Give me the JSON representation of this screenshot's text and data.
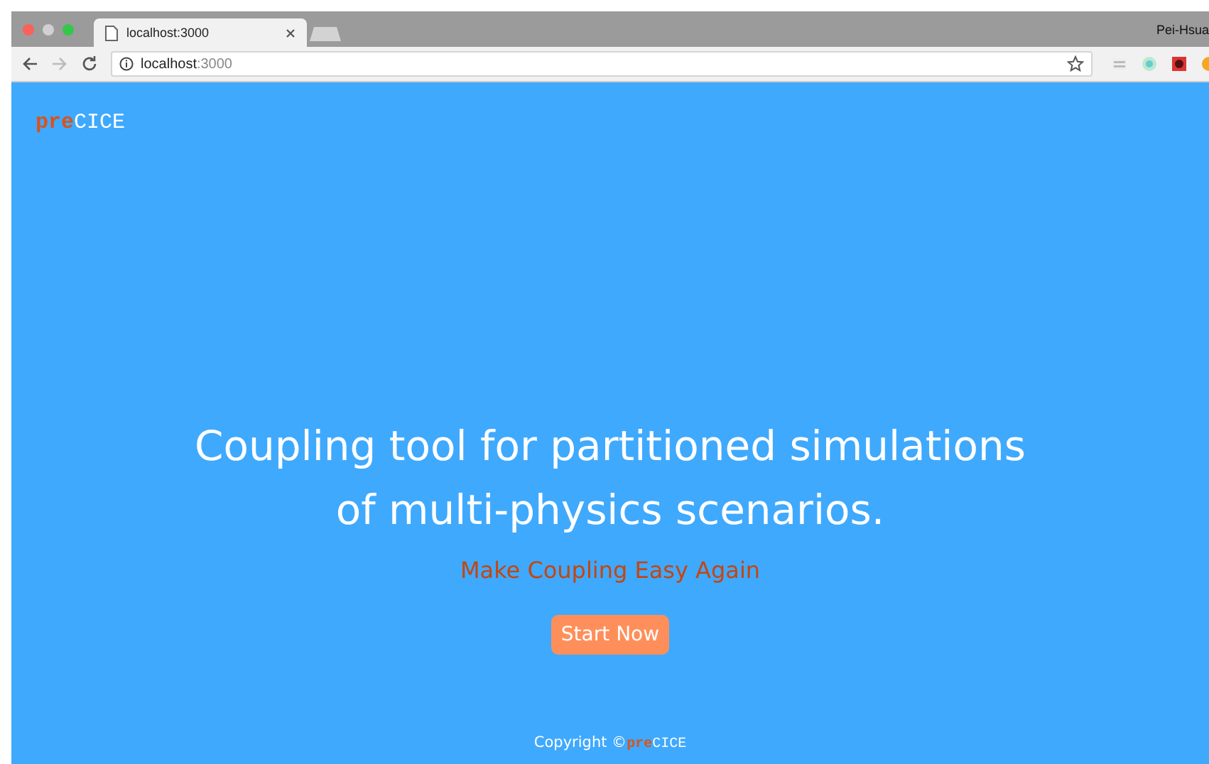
{
  "browser": {
    "tab_title": "localhost:3000",
    "profile": "Pei-Hsua",
    "address_host": "localhost",
    "address_port": ":3000"
  },
  "logo": {
    "prefix": "pre",
    "suffix": "CICE"
  },
  "hero": {
    "headline_lines": [
      "Coupling tool for partitioned simulations",
      "of multi-physics scenarios."
    ],
    "tagline": "Make Coupling Easy Again",
    "button": "Start Now"
  },
  "footer": {
    "copyright": "Copyright ©",
    "logo_prefix": "pre",
    "logo_suffix": "CICE"
  }
}
